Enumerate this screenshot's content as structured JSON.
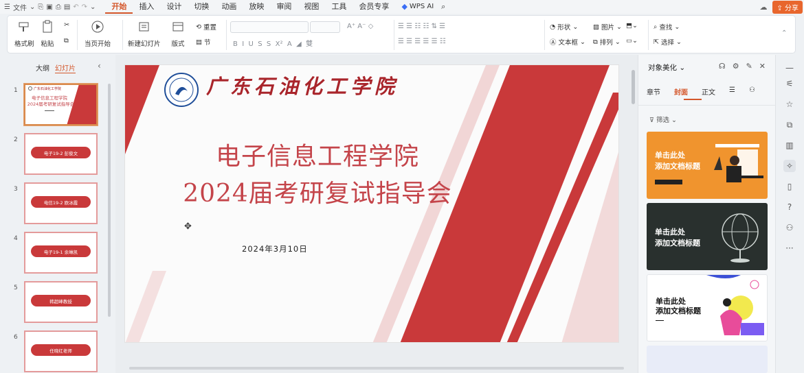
{
  "topbar": {
    "menu_label": "文件",
    "tabs": [
      "开始",
      "插入",
      "设计",
      "切换",
      "动画",
      "放映",
      "审阅",
      "视图",
      "工具",
      "会员专享"
    ],
    "wps_ai": "WPS AI",
    "share": "分享"
  },
  "ribbon": {
    "format_painter": "格式刷",
    "paste": "粘贴",
    "play_from_current": "当页开始",
    "new_slide": "新建幻灯片",
    "layout": "版式",
    "reset": "重置",
    "section": "节",
    "shape": "形状",
    "picture": "图片",
    "find": "查找",
    "textbox": "文本框",
    "arrange": "排列",
    "select": "选择"
  },
  "left_panel": {
    "tab_outline": "大纲",
    "tab_slides": "幻灯片",
    "thumbs": [
      {
        "num": "1",
        "line1": "电子信息工程学院",
        "line2": "2024届考研复试指导会"
      },
      {
        "num": "2",
        "label": "电子19-2 彭俊文"
      },
      {
        "num": "3",
        "label": "电信19-2 欧冰霞"
      },
      {
        "num": "4",
        "label": "电子19-1 余琳凯"
      },
      {
        "num": "5",
        "label": "韩超峰教授"
      },
      {
        "num": "6",
        "label": "任晓红老师"
      }
    ]
  },
  "slide": {
    "school_name": "广东石油化工学院",
    "title_line1": "电子信息工程学院",
    "title_line2": "2024届考研复试指导会",
    "date": "2024年3月10日"
  },
  "right_panel": {
    "title": "对象美化",
    "tabs": [
      "章节",
      "封面",
      "正文"
    ],
    "filter": "筛选",
    "cards": [
      {
        "line1": "单击此处",
        "line2": "添加文档标题"
      },
      {
        "line1": "单击此处",
        "line2": "添加文档标题"
      },
      {
        "line1": "单击此处",
        "line2": "添加文档标题"
      }
    ]
  },
  "colors": {
    "accent": "#d4562a",
    "slide_red": "#c9393a",
    "share_bg": "#e8662d"
  }
}
